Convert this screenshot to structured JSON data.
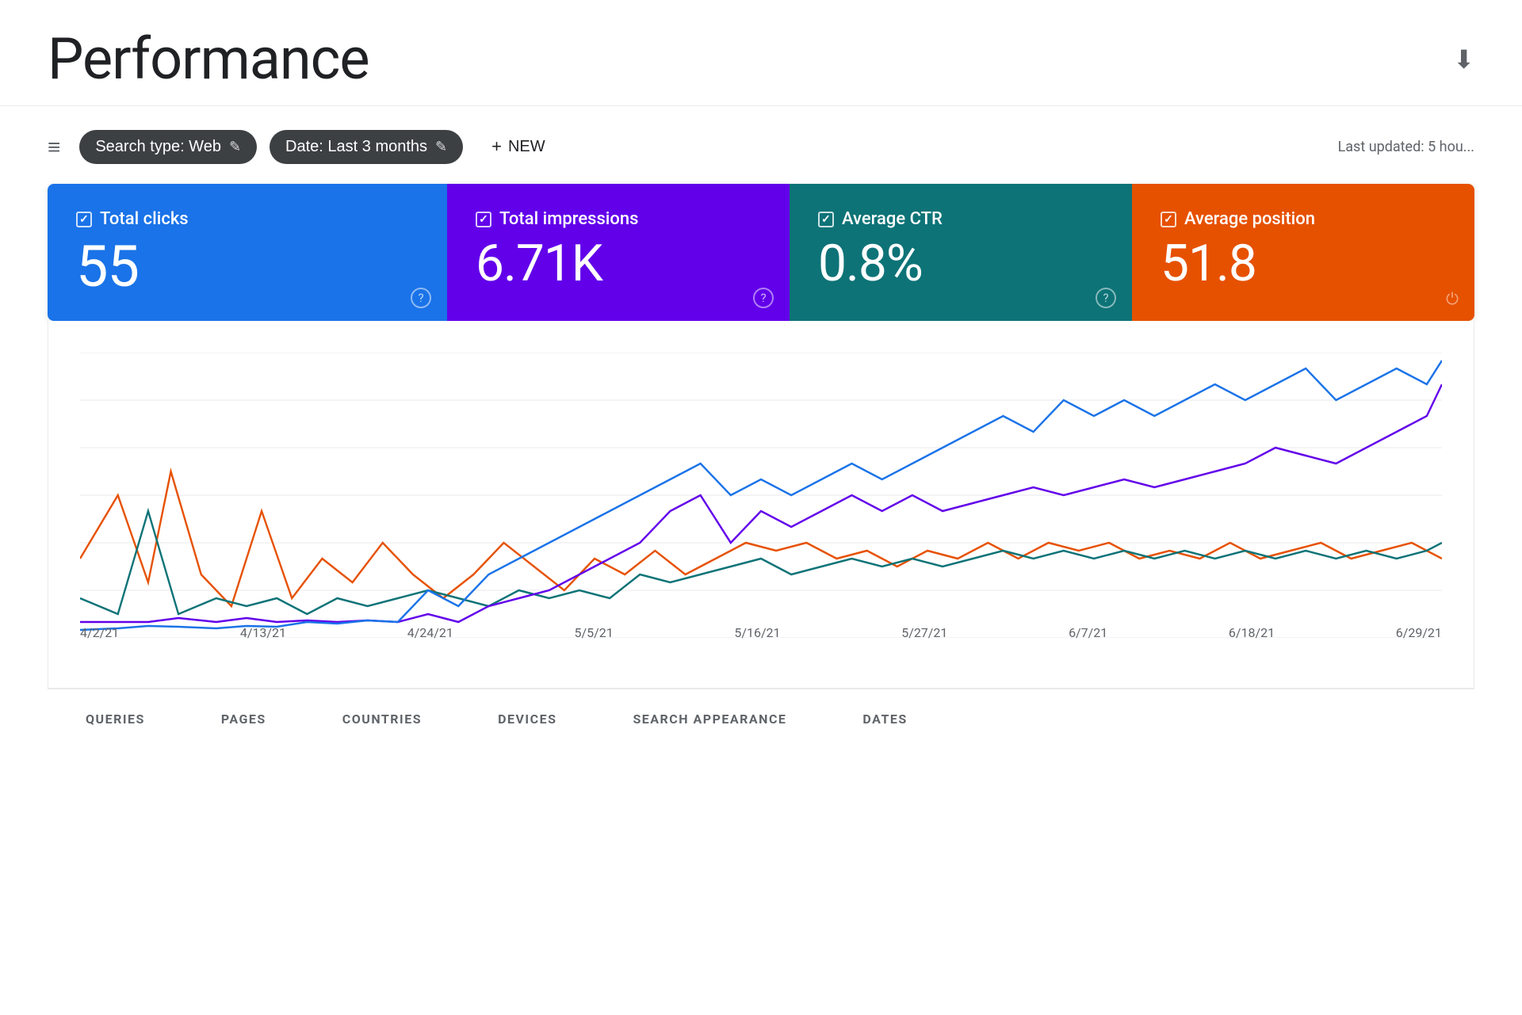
{
  "header": {
    "title": "Performance",
    "last_updated": "Last updated: 5 hou..."
  },
  "toolbar": {
    "search_type_label": "Search type: Web",
    "date_label": "Date: Last 3 months",
    "new_label": "NEW",
    "filter_icon": "≡",
    "edit_icon": "✎",
    "plus_icon": "+"
  },
  "metrics": [
    {
      "id": "clicks",
      "label": "Total clicks",
      "value": "55",
      "color": "#1a73e8",
      "has_info": true,
      "info_type": "circle"
    },
    {
      "id": "impressions",
      "label": "Total impressions",
      "value": "6.71K",
      "color": "#6200ea",
      "has_info": true,
      "info_type": "circle"
    },
    {
      "id": "ctr",
      "label": "Average CTR",
      "value": "0.8%",
      "color": "#0d7377",
      "has_info": true,
      "info_type": "circle"
    },
    {
      "id": "position",
      "label": "Average position",
      "value": "51.8",
      "color": "#e65100",
      "has_info": true,
      "info_type": "power"
    }
  ],
  "chart": {
    "x_labels": [
      "4/2/21",
      "4/13/21",
      "4/24/21",
      "5/5/21",
      "5/16/21",
      "5/27/21",
      "6/7/21",
      "6/18/21",
      "6/29/21"
    ],
    "lines": {
      "clicks": {
        "color": "#1a73e8",
        "label": "Total clicks"
      },
      "impressions": {
        "color": "#aa46be",
        "label": "Total impressions"
      },
      "ctr": {
        "color": "#12b5cb",
        "label": "Average CTR"
      },
      "position": {
        "color": "#e65100",
        "label": "Average position"
      }
    }
  },
  "bottom_tabs": [
    {
      "id": "queries",
      "label": "QUERIES"
    },
    {
      "id": "pages",
      "label": "PAGES"
    },
    {
      "id": "countries",
      "label": "COUNTRIES"
    },
    {
      "id": "devices",
      "label": "DEVICES"
    },
    {
      "id": "search_appearance",
      "label": "SEARCH APPEARANCE"
    },
    {
      "id": "dates",
      "label": "DATES"
    }
  ]
}
